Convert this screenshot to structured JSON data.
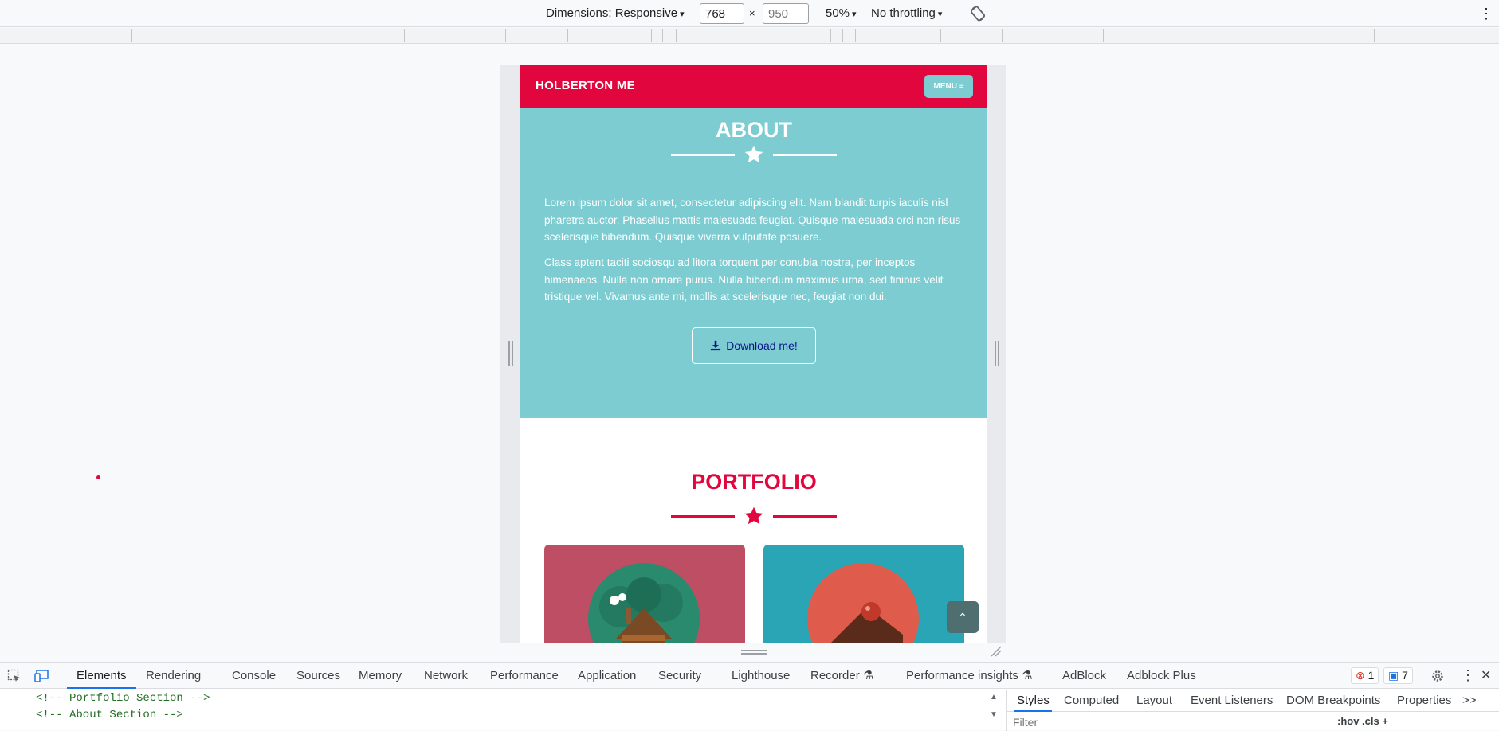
{
  "device_toolbar": {
    "dimensions_label": "Dimensions: Responsive",
    "width": "768",
    "height_placeholder": "950",
    "times": "×",
    "zoom": "50%",
    "throttling": "No throttling",
    "caret": "▾",
    "more_icon": "⋮"
  },
  "site": {
    "brand": "HOLBERTON ME",
    "menu_label": "MENU ≡",
    "about": {
      "title": "ABOUT",
      "paragraph_1": "Lorem ipsum dolor sit amet, consectetur adipiscing elit. Nam blandit turpis iaculis nisl pharetra auctor. Phasellus mattis malesuada feugiat. Quisque malesuada orci non risus scelerisque bibendum. Quisque viverra vulputate posuere.",
      "paragraph_2": "Class aptent taciti sociosqu ad litora torquent per conubia nostra, per inceptos himenaeos. Nulla non ornare purus. Nulla bibendum maximus urna, sed finibus velit tristique vel. Vivamus ante mi, mollis at scelerisque nec, feugiat non dui.",
      "download_label": "Download me!"
    },
    "portfolio": {
      "title": "PORTFOLIO",
      "cards": [
        {
          "icon": "cabin-icon",
          "color": "#bd4e63"
        },
        {
          "icon": "cake-icon",
          "color": "#2aa5b5"
        }
      ]
    },
    "scroll_top_label": "⌃",
    "colors": {
      "primary": "#e1063e",
      "teal": "#7dccd1",
      "dark_teal": "#4e6e6f"
    }
  },
  "devtools": {
    "tabs": [
      "Elements",
      "Rendering",
      "Console",
      "Sources",
      "Memory",
      "Network",
      "Performance",
      "Application",
      "Security",
      "Lighthouse",
      "Recorder",
      "Performance insights",
      "AdBlock",
      "Adblock Plus"
    ],
    "errors_count": "1",
    "messages_count": "7",
    "dom_lines": [
      "<!-- Portfolio Section -->",
      "<!-- About Section -->"
    ],
    "styles_tabs": [
      "Styles",
      "Computed",
      "Layout",
      "Event Listeners",
      "DOM Breakpoints",
      "Properties"
    ],
    "overflow_label": ">>",
    "filter_placeholder": "Filter",
    "filter_tools": ":hov  .cls  +"
  }
}
